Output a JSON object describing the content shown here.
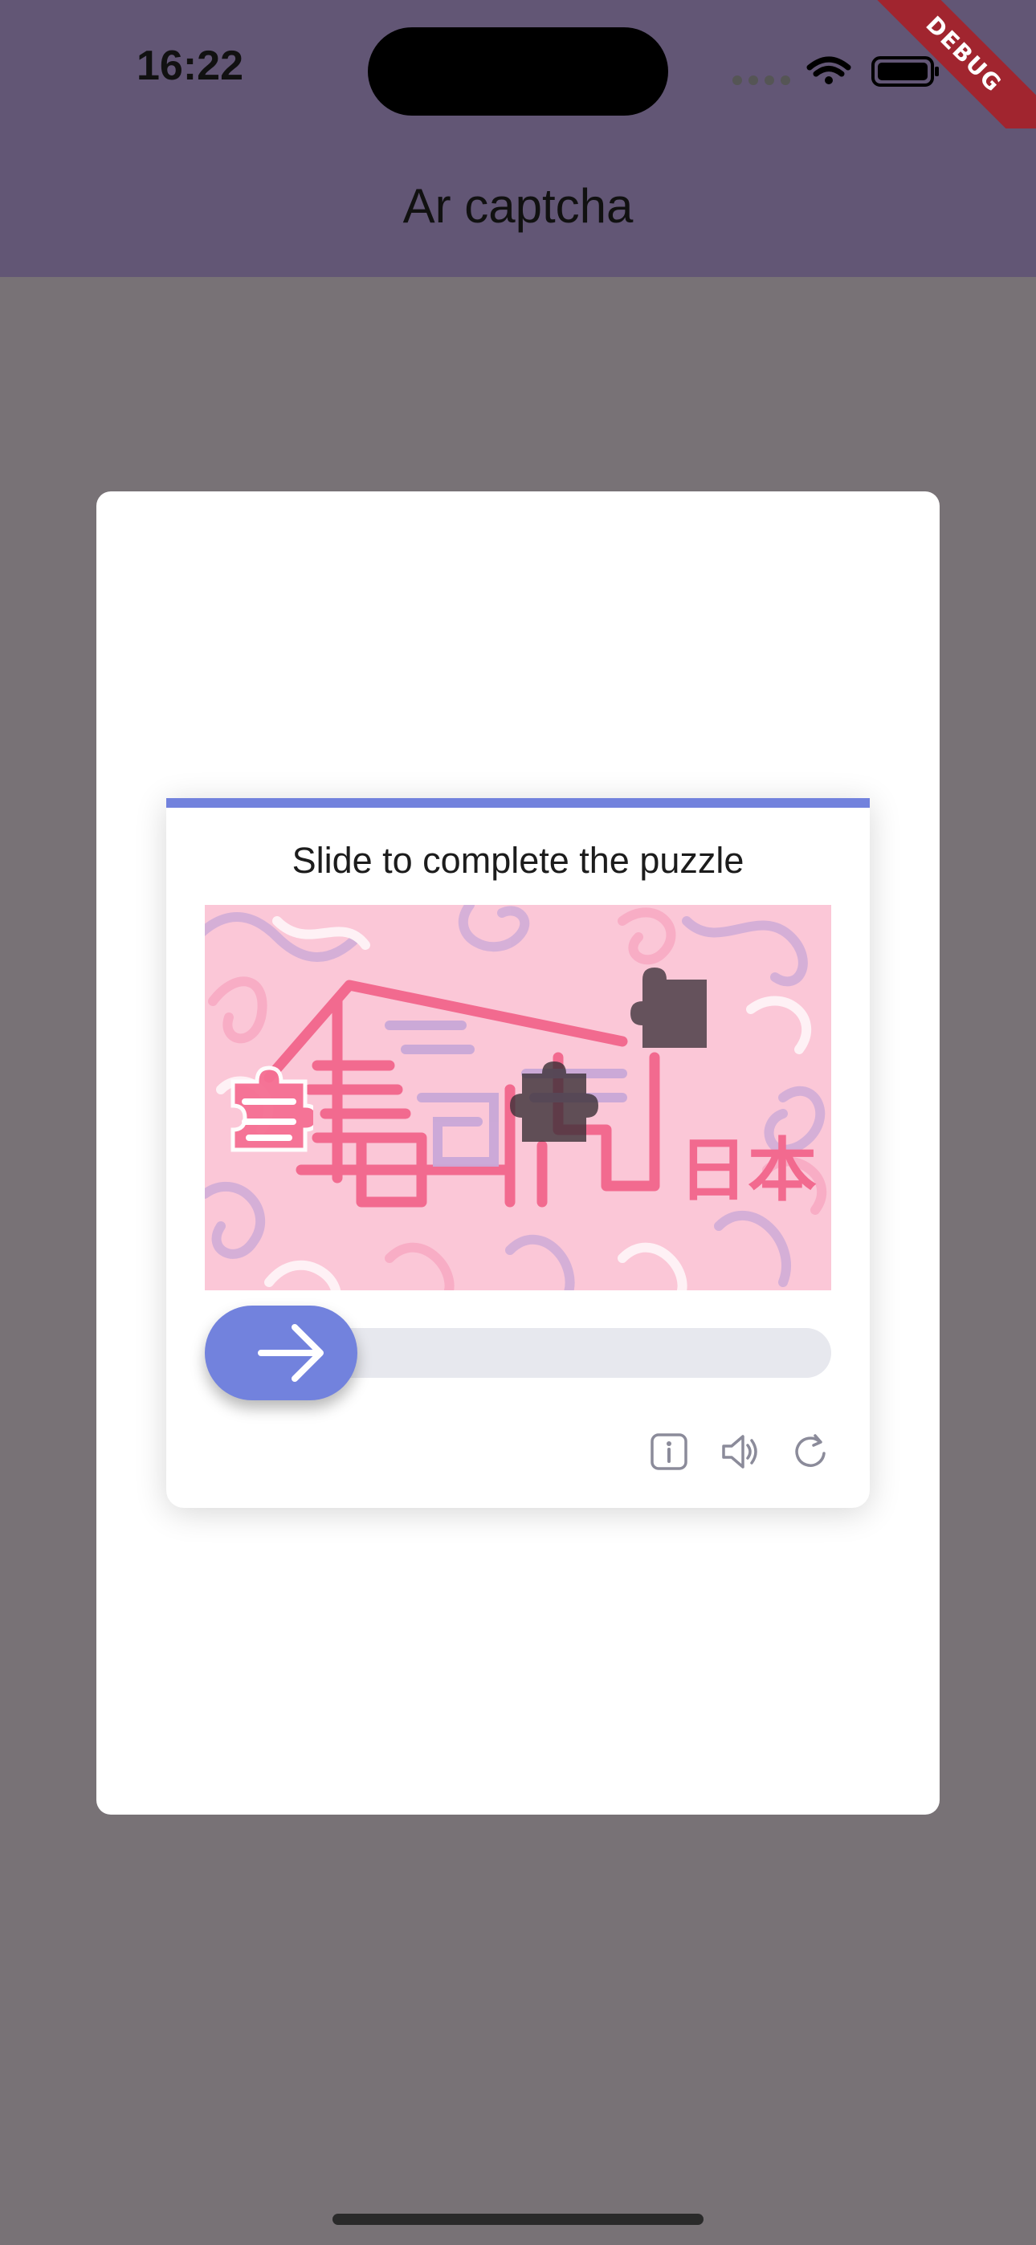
{
  "status_bar": {
    "time": "16:22",
    "debug_label": "DEBUG"
  },
  "app_bar": {
    "title": "Ar captcha"
  },
  "captcha": {
    "title": "Slide to complete the puzzle",
    "image_text": "日本",
    "accent_color": "#7282dd",
    "tools": [
      {
        "icon": "info-icon"
      },
      {
        "icon": "audio-icon"
      },
      {
        "icon": "refresh-icon"
      }
    ]
  }
}
